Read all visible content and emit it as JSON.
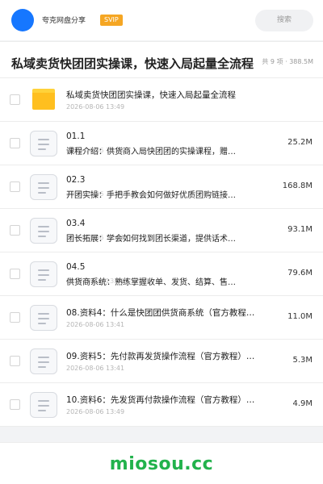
{
  "header": {
    "brand": "夸克网盘分享",
    "badge": "SVIP",
    "search_placeholder": "搜索",
    "avatar_color": "#1677ff"
  },
  "title": {
    "text": "私域卖货快团团实操课，快速入局起量全流程",
    "count": "共 9 项 · 388.5M"
  },
  "files": [
    {
      "icon": "folder-icon",
      "name": "私域卖货快团团实操课，快速入局起量全流程",
      "date": "2026-08-06 13:49",
      "size": ""
    },
    {
      "icon": "document-icon",
      "name": "01.1",
      "desc": "课程介绍：供货商入局快团团的实操课程，赠…",
      "date": "2026-08-06 13:41",
      "size": "25.2M"
    },
    {
      "icon": "document-icon",
      "name": "02.3",
      "desc": "开团实操：手把手教会如何做好优质团购链接…",
      "date": "2026-08-06 13:41",
      "size": "168.8M"
    },
    {
      "icon": "document-icon",
      "name": "03.4",
      "desc": "团长拓展：学会如何找到团长渠道，提供话术…",
      "date": "2026-08-06 13:41",
      "size": "93.1M"
    },
    {
      "icon": "document-icon",
      "name": "04.5",
      "desc": "供货商系统：熟练掌握收单、发货、结算、售…",
      "date": "2026-08-06 13:41",
      "size": "79.6M"
    },
    {
      "icon": "document-icon",
      "name": "08.资料4：什么是快团团供货商系统（官方教程）.…",
      "date": "2026-08-06 13:41",
      "size": "11.0M"
    },
    {
      "icon": "document-icon",
      "name": "09.资料5：先付款再发货操作流程（官方教程）.m…",
      "date": "2026-08-06 13:41",
      "size": "5.3M"
    },
    {
      "icon": "document-icon",
      "name": "10.资料6：先发货再付款操作流程（官方教程）【公…",
      "date": "2026-08-06 13:49",
      "size": "4.9M"
    }
  ],
  "footer": {
    "watermark": "miosou.cc",
    "watermark_color": "#22b24c"
  }
}
